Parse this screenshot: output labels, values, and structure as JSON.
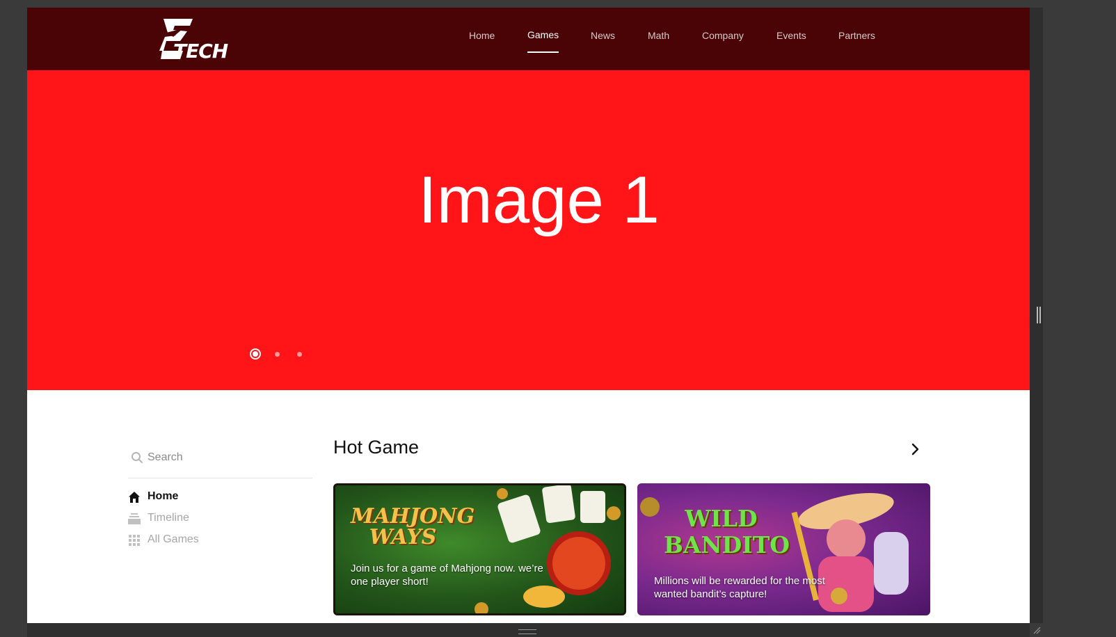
{
  "brand": {
    "logo_text": "TECH",
    "header_color": "#4a0405"
  },
  "nav": {
    "items": [
      {
        "label": "Home"
      },
      {
        "label": "Games"
      },
      {
        "label": "News"
      },
      {
        "label": "Math"
      },
      {
        "label": "Company"
      },
      {
        "label": "Events"
      },
      {
        "label": "Partners"
      }
    ],
    "active": "Games"
  },
  "hero": {
    "slide_text": "Image 1",
    "background": "#ff1518",
    "slides_total": 3,
    "active_slide": 1
  },
  "sidebar": {
    "search_placeholder": "Search",
    "items": [
      {
        "label": "Home",
        "icon": "home-icon",
        "active": true
      },
      {
        "label": "Timeline",
        "icon": "timeline-icon",
        "active": false
      },
      {
        "label": "All Games",
        "icon": "grid-icon",
        "active": false
      }
    ]
  },
  "main": {
    "section_title": "Hot Game",
    "cards": [
      {
        "logo": "MAHJONG WAYS",
        "caption": "Join us for a game of Mahjong now. we’re one player short!"
      },
      {
        "logo": "WILD BANDITO",
        "caption": "Millions will be rewarded for the most wanted bandit’s capture!"
      }
    ]
  }
}
